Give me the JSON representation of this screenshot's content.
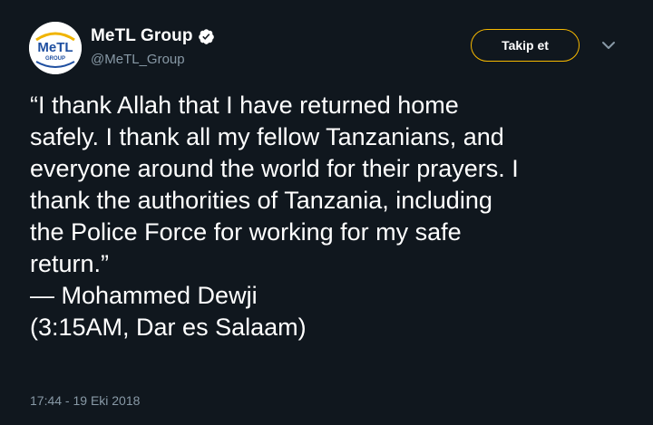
{
  "account": {
    "avatar_lettering": "MeTL",
    "avatar_sub": "GROUP",
    "display_name": "MeTL Group",
    "handle": "@MeTL_Group",
    "verified_icon": "verified-badge-icon"
  },
  "actions": {
    "follow_label": "Takip et",
    "more_icon": "chevron-down-icon"
  },
  "tweet": {
    "lines": [
      "“I thank Allah that I have returned home",
      "safely. I thank all my fellow Tanzanians, and",
      "everyone around the world for their prayers. I",
      "thank the authorities of Tanzania, including",
      "the Police Force for working for my safe",
      "return.”",
      "— Mohammed Dewji",
      "(3:15AM, Dar es Salaam)"
    ],
    "timestamp": "17:44 - 19 Eki 2018"
  },
  "colors": {
    "background": "#10171e",
    "text": "#ffffff",
    "muted": "#8899a6",
    "follow_border": "#f7b900"
  }
}
